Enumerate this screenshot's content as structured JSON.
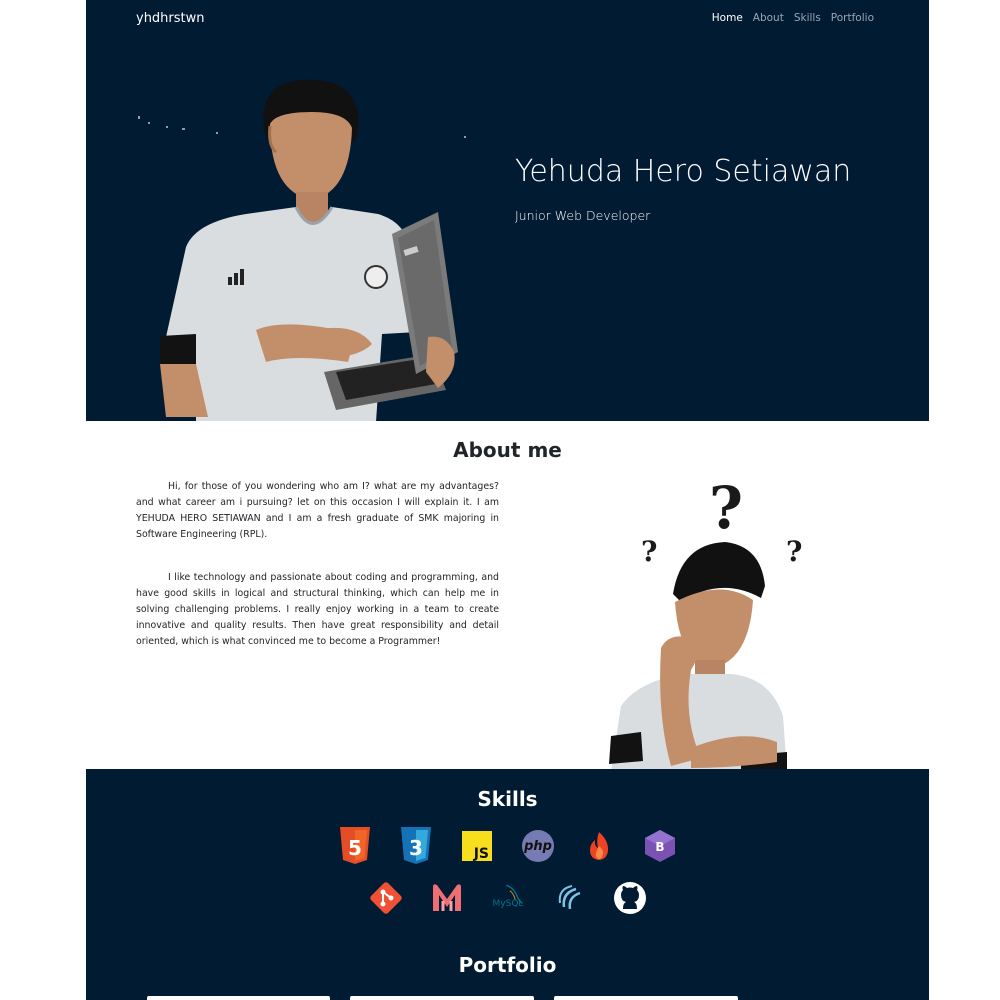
{
  "navbar": {
    "brand": "yhdhrstwn",
    "links": [
      "Home",
      "About",
      "Skills",
      "Portfolio"
    ]
  },
  "hero": {
    "name": "Yehuda Hero Setiawan",
    "role": "Junior Web Developer"
  },
  "about": {
    "title": "About me",
    "paragraphs": [
      "Hi, for those of you wondering who am I? what are my advantages? and what career am i pursuing? let on this occasion I will explain it. I am YEHUDA HERO SETIAWAN and I am a fresh graduate of SMK majoring in Software Engineering (RPL).",
      "I like technology and passionate about coding and programming, and have good skills in logical and structural thinking, which can help me in solving challenging problems. I really enjoy working in a team to create innovative and quality results. Then have great responsibility and detail oriented, which is what convinced me to become a Programmer!"
    ]
  },
  "skills": {
    "title": "Skills",
    "row1": [
      "html5-icon",
      "css3-icon",
      "javascript-icon",
      "php-icon",
      "codeigniter-icon",
      "bootstrap-icon"
    ],
    "row2": [
      "git-icon",
      "materialize-icon",
      "mysql-icon",
      "wordpress-icon",
      "github-icon"
    ],
    "html5_text": "5",
    "css3_text": "3",
    "js_text": "JS",
    "php_text": "php",
    "bootstrap_text": "B",
    "mysql_text": "MySQL"
  },
  "portfolio": {
    "title": "Portfolio"
  },
  "colors": {
    "navy": "#011b33",
    "html5": "#e44d26",
    "css3": "#1572b6",
    "js": "#f7df1e",
    "php": "#777bb3",
    "codeigniter": "#ee4323",
    "bootstrap": "#7952b3",
    "git": "#f05033",
    "materialize": "#ee6e73",
    "mysql": "#00758f"
  }
}
